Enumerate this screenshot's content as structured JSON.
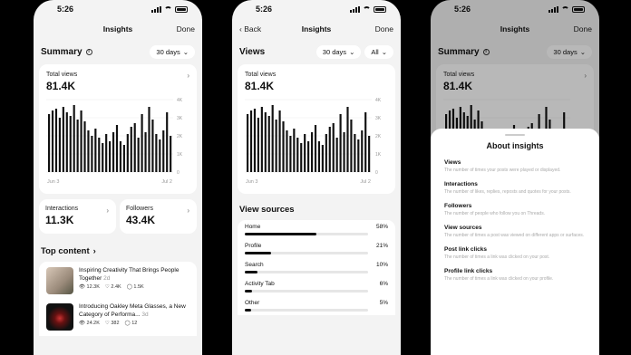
{
  "status_time": "5:26",
  "colors": {
    "bar": "#111111",
    "bg": "#f3f3f3",
    "card": "#ffffff"
  },
  "phone1": {
    "nav": {
      "title": "Insights",
      "done": "Done"
    },
    "summary": {
      "title": "Summary",
      "range": "30 days"
    },
    "total": {
      "label": "Total views",
      "value": "81.4K",
      "start": "Jun 3",
      "end": "Jul 2",
      "yticks": [
        "4K",
        "3K",
        "2K",
        "1K",
        "0"
      ]
    },
    "interactions": {
      "label": "Interactions",
      "value": "11.3K"
    },
    "followers": {
      "label": "Followers",
      "value": "43.4K"
    },
    "top_content": "Top content",
    "posts": [
      {
        "text": "Inspiring Creativity That Brings People Together",
        "age": "2d",
        "views": "12.3K",
        "likes": "2.4K",
        "replies": "1.5K"
      },
      {
        "text": "Introducing Oakley Meta Glasses, a New Category of Performa...",
        "age": "3d",
        "views": "24.2K",
        "likes": "382",
        "replies": "12"
      }
    ]
  },
  "phone2": {
    "nav": {
      "title": "Insights",
      "back": "Back",
      "done": "Done"
    },
    "views": {
      "title": "Views",
      "range": "30 days",
      "filter": "All"
    },
    "total": {
      "label": "Total views",
      "value": "81.4K",
      "start": "Jun 3",
      "end": "Jul 2",
      "yticks": [
        "4K",
        "3K",
        "2K",
        "1K",
        "0"
      ]
    },
    "sources_title": "View sources",
    "sources": [
      {
        "name": "Home",
        "pct": "58%",
        "value": 58
      },
      {
        "name": "Profile",
        "pct": "21%",
        "value": 21
      },
      {
        "name": "Search",
        "pct": "10%",
        "value": 10
      },
      {
        "name": "Activity Tab",
        "pct": "6%",
        "value": 6
      },
      {
        "name": "Other",
        "pct": "5%",
        "value": 5
      }
    ]
  },
  "phone3": {
    "nav": {
      "title": "Insights",
      "done": "Done"
    },
    "summary": {
      "title": "Summary",
      "range": "30 days"
    },
    "total": {
      "label": "Total views",
      "value": "81.4K"
    },
    "sheet": {
      "title": "About insights",
      "items": [
        {
          "term": "Views",
          "desc": "The number of times your posts were played or displayed."
        },
        {
          "term": "Interactions",
          "desc": "The number of likes, replies, reposts and quotes for your posts."
        },
        {
          "term": "Followers",
          "desc": "The number of people who follow you on Threads."
        },
        {
          "term": "View sources",
          "desc": "The number of times a post was viewed on different apps or surfaces."
        },
        {
          "term": "Post link clicks",
          "desc": "The number of times a link was clicked on your post."
        },
        {
          "term": "Profile link clicks",
          "desc": "The number of times a link was clicked on your profile."
        }
      ]
    }
  },
  "chart_data": {
    "type": "bar",
    "title": "",
    "xlabel": "",
    "ylabel": "",
    "x_start": "Jun 3",
    "x_end": "Jul 2",
    "ylim": [
      0,
      4000
    ],
    "yticks": [
      "4K",
      "3K",
      "2K",
      "1K",
      "0"
    ],
    "values": [
      3200,
      3400,
      3500,
      3000,
      3600,
      3300,
      3100,
      3700,
      2900,
      3400,
      2800,
      2300,
      2000,
      2400,
      1900,
      1600,
      2100,
      1700,
      2200,
      2600,
      1700,
      1500,
      2100,
      2500,
      2700,
      1900,
      3200,
      2200,
      3600,
      2900,
      2100,
      1800,
      2300,
      3300,
      2000
    ]
  }
}
